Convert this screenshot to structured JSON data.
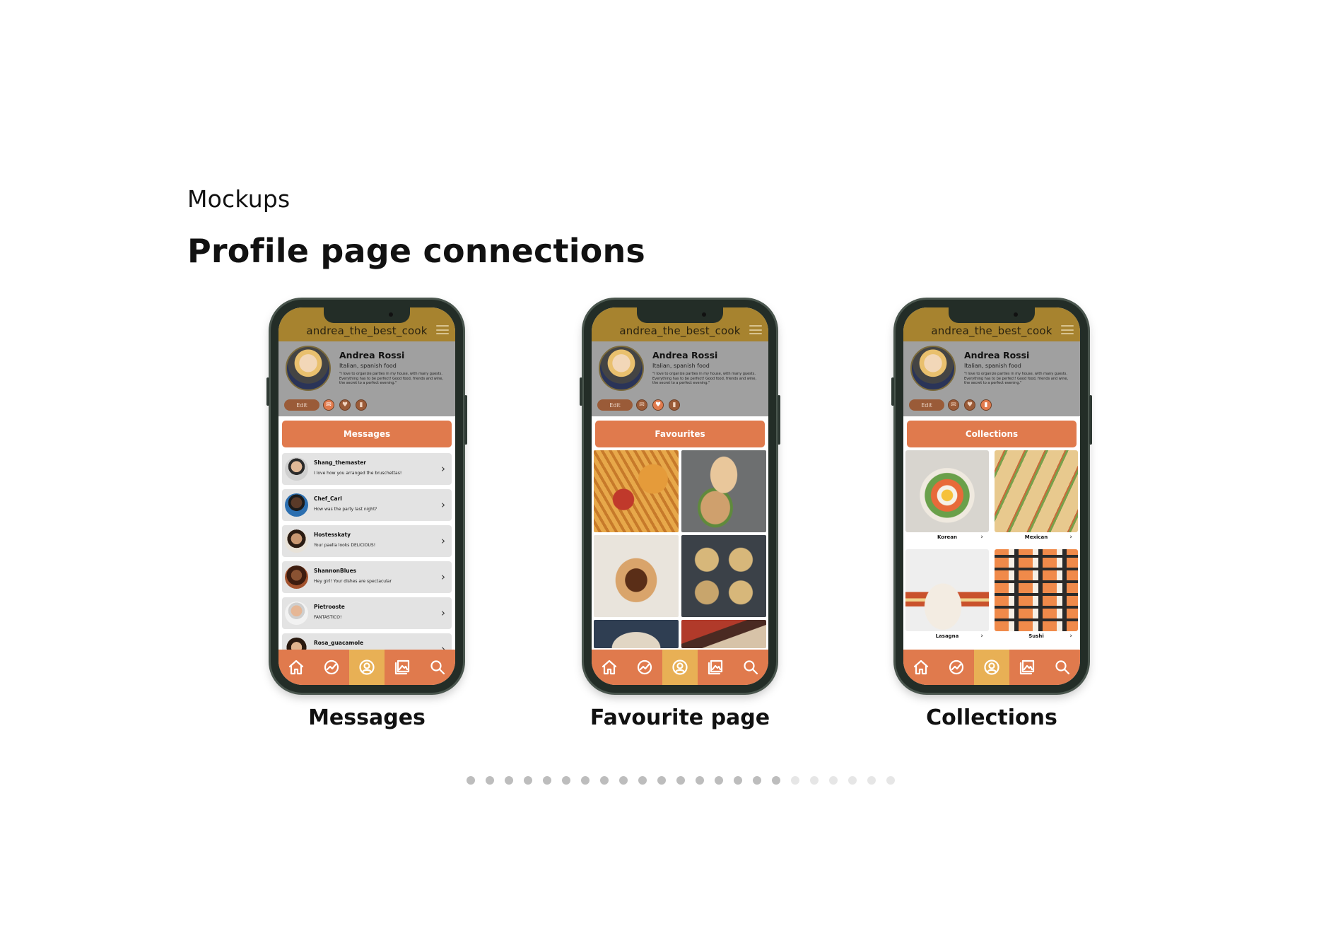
{
  "page": {
    "subtitle": "Mockups",
    "title": "Profile page connections"
  },
  "colors": {
    "accent_orange": "#e07a4d",
    "active_nav": "#e8b055",
    "topbar_gold": "#a7832f",
    "profile_gray": "#a0a0a0",
    "phone_frame": "#232d27"
  },
  "profile": {
    "username": "andrea_the_best_cook",
    "name": "Andrea Rossi",
    "food": "Italian, spanish food",
    "bio": "\"I love to organize parties in my house, with many guests. Everything has to be perfect! Good food, friends and wine, the secret to a perfect evening.\"",
    "edit_label": "Edit"
  },
  "mockups": [
    {
      "caption": "Messages",
      "section_label": "Messages",
      "messages": [
        {
          "name": "Shang_themaster",
          "text": "I love how you arranged the bruschettas!"
        },
        {
          "name": "Chef_Carl",
          "text": "How was the party last night?"
        },
        {
          "name": "Hostesskaty",
          "text": "Your paella looks DELICIOUS!"
        },
        {
          "name": "ShannonBlues",
          "text": "Hey girl! Your dishes are spectacular"
        },
        {
          "name": "Pietrooste",
          "text": "FANTASTICO!"
        },
        {
          "name": "Rosa_guacamole",
          "text": ""
        }
      ]
    },
    {
      "caption": "Favourite page",
      "section_label": "Favourites"
    },
    {
      "caption": "Collections",
      "section_label": "Collections",
      "collections": [
        "Korean",
        "Mexican",
        "Lasagna",
        "Sushi"
      ]
    }
  ],
  "nav_icons": [
    "home-icon",
    "trending-icon",
    "profile-icon",
    "gallery-icon",
    "search-icon"
  ],
  "pagination": {
    "total": 23,
    "active_count": 17
  }
}
